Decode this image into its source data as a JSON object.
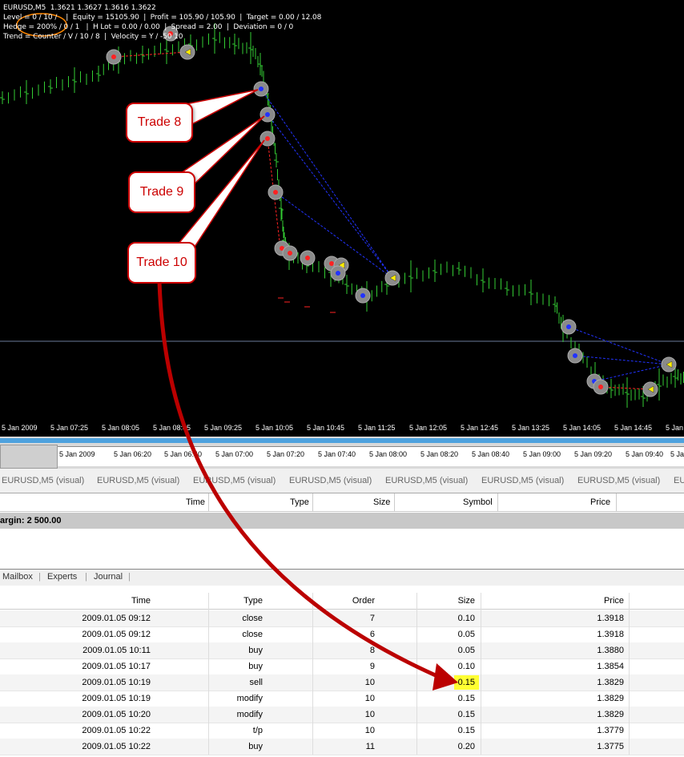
{
  "chart": {
    "header_lines": [
      "EURUSD,M5  1.3621 1.3627 1.3616 1.3622",
      "Level = 0 / 10 /    |  Equity = 15105.90  |  Profit = 105.90 / 105.90  |  Target = 0.00 / 12.08",
      "Hedge = 200% / 0 / 1   |  H Lot = 0.00 / 0.00  |  Spread = 2.00  |  Deviation = 0 / 0",
      "Trend = Counter / V / 10 / 8  |  Velocity = Y / -50 10"
    ],
    "callouts": [
      "Trade 8",
      "Trade 9",
      "Trade 10"
    ],
    "time_axis": [
      "5 Jan 2009",
      "5 Jan 07:25",
      "5 Jan 08:05",
      "5 Jan 08:45",
      "5 Jan 09:25",
      "5 Jan 10:05",
      "5 Jan 10:45",
      "5 Jan 11:25",
      "5 Jan 12:05",
      "5 Jan 12:45",
      "5 Jan 13:25",
      "5 Jan 14:05",
      "5 Jan 14:45",
      "5 Jan"
    ],
    "colors": {
      "background": "#000000",
      "candle": "#33cc33",
      "buy_line": "#2233ff",
      "sell_line": "#ff2222",
      "callout_border": "#cc0000",
      "arrow": "#bb0000"
    }
  },
  "overview": {
    "time_axis": [
      "5 Jan 2009",
      "5 Jan 06:20",
      "5 Jan 06:40",
      "5 Jan 07:00",
      "5 Jan 07:20",
      "5 Jan 07:40",
      "5 Jan 08:00",
      "5 Jan 08:20",
      "5 Jan 08:40",
      "5 Jan 09:00",
      "5 Jan 09:20",
      "5 Jan 09:40",
      "5 Ja"
    ]
  },
  "chart_tabs": [
    "EURUSD,M5 (visual)",
    "EURUSD,M5 (visual)",
    "EURUSD,M5 (visual)",
    "EURUSD,M5 (visual)",
    "EURUSD,M5 (visual)",
    "EURUSD,M5 (visual)",
    "EURUSD,M5 (visual)",
    "EURU"
  ],
  "trade_header": {
    "time": "Time",
    "type": "Type",
    "size": "Size",
    "symbol": "Symbol",
    "price": "Price"
  },
  "margin_text": "argin: 2 500.00",
  "terminal_tabs": [
    "Mailbox",
    "Experts",
    "Journal"
  ],
  "history": {
    "columns": [
      "Time",
      "Type",
      "Order",
      "Size",
      "Price"
    ],
    "rows": [
      {
        "time": "2009.01.05 09:12",
        "type": "close",
        "order": "7",
        "size": "0.10",
        "price": "1.3918"
      },
      {
        "time": "2009.01.05 09:12",
        "type": "close",
        "order": "6",
        "size": "0.05",
        "price": "1.3918"
      },
      {
        "time": "2009.01.05 10:11",
        "type": "buy",
        "order": "8",
        "size": "0.05",
        "price": "1.3880"
      },
      {
        "time": "2009.01.05 10:17",
        "type": "buy",
        "order": "9",
        "size": "0.10",
        "price": "1.3854"
      },
      {
        "time": "2009.01.05 10:19",
        "type": "sell",
        "order": "10",
        "size": "0.15",
        "price": "1.3829"
      },
      {
        "time": "2009.01.05 10:19",
        "type": "modify",
        "order": "10",
        "size": "0.15",
        "price": "1.3829"
      },
      {
        "time": "2009.01.05 10:20",
        "type": "modify",
        "order": "10",
        "size": "0.15",
        "price": "1.3829"
      },
      {
        "time": "2009.01.05 10:22",
        "type": "t/p",
        "order": "10",
        "size": "0.15",
        "price": "1.3779"
      },
      {
        "time": "2009.01.05 10:22",
        "type": "buy",
        "order": "11",
        "size": "0.20",
        "price": "1.3775"
      }
    ],
    "highlight_row": 4
  }
}
